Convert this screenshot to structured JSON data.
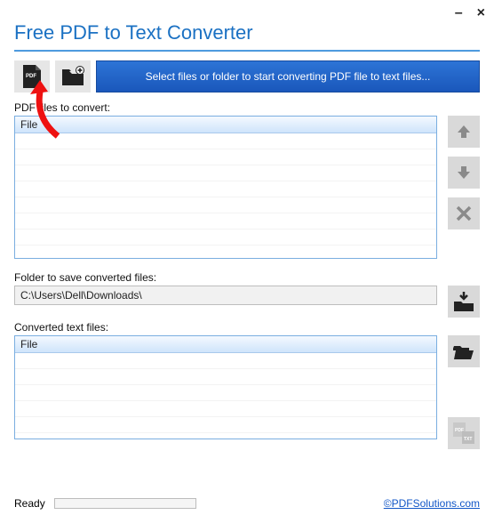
{
  "window": {
    "minimize": "–",
    "close": "×"
  },
  "title": "Free PDF to Text Converter",
  "toolbar": {
    "main_action": "Select files or folder to start converting PDF file to text files..."
  },
  "labels": {
    "source": "PDF files to convert:",
    "folder": "Folder to save converted files:",
    "output": "Converted text files:"
  },
  "columns": {
    "file": "File"
  },
  "folder_path": "C:\\Users\\Dell\\Downloads\\",
  "status": {
    "text": "Ready"
  },
  "footer": {
    "link": "©PDFSolutions.com"
  }
}
